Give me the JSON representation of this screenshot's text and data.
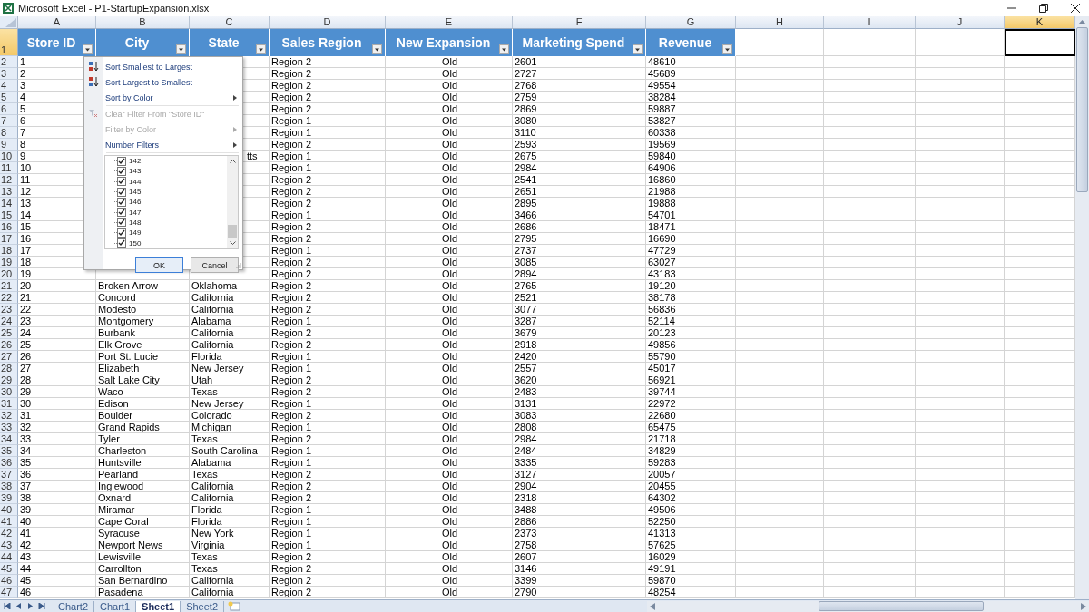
{
  "window": {
    "title": "Microsoft Excel - P1-StartupExpansion.xlsx"
  },
  "columns": [
    {
      "label": "A",
      "selected": false
    },
    {
      "label": "B",
      "selected": false
    },
    {
      "label": "C",
      "selected": false
    },
    {
      "label": "D",
      "selected": false
    },
    {
      "label": "E",
      "selected": false
    },
    {
      "label": "F",
      "selected": false
    },
    {
      "label": "G",
      "selected": false
    },
    {
      "label": "H",
      "selected": false
    },
    {
      "label": "I",
      "selected": false
    },
    {
      "label": "J",
      "selected": false
    },
    {
      "label": "K",
      "selected": true
    }
  ],
  "header_row": {
    "row": "1",
    "selected": true,
    "cells": [
      "Store ID",
      "City",
      "State",
      "Sales Region",
      "New Expansion",
      "Marketing Spend",
      "Revenue"
    ]
  },
  "rows": [
    {
      "row": "2",
      "selected": false,
      "store_id": "1",
      "sales_region": "Region 2",
      "new_expansion": "Old",
      "marketing_spend": "2601",
      "revenue": "48610"
    },
    {
      "row": "3",
      "selected": false,
      "store_id": "2",
      "sales_region": "Region 2",
      "new_expansion": "Old",
      "marketing_spend": "2727",
      "revenue": "45689"
    },
    {
      "row": "4",
      "selected": false,
      "store_id": "3",
      "sales_region": "Region 2",
      "new_expansion": "Old",
      "marketing_spend": "2768",
      "revenue": "49554"
    },
    {
      "row": "5",
      "selected": false,
      "store_id": "4",
      "sales_region": "Region 2",
      "new_expansion": "Old",
      "marketing_spend": "2759",
      "revenue": "38284"
    },
    {
      "row": "6",
      "selected": false,
      "store_id": "5",
      "sales_region": "Region 2",
      "new_expansion": "Old",
      "marketing_spend": "2869",
      "revenue": "59887"
    },
    {
      "row": "7",
      "selected": false,
      "store_id": "6",
      "sales_region": "Region 1",
      "new_expansion": "Old",
      "marketing_spend": "3080",
      "revenue": "53827"
    },
    {
      "row": "8",
      "selected": false,
      "store_id": "7",
      "sales_region": "Region 1",
      "new_expansion": "Old",
      "marketing_spend": "3110",
      "revenue": "60338"
    },
    {
      "row": "9",
      "selected": false,
      "store_id": "8",
      "sales_region": "Region 2",
      "new_expansion": "Old",
      "marketing_spend": "2593",
      "revenue": "19569"
    },
    {
      "row": "10",
      "selected": false,
      "store_id": "9",
      "state_tail": "tts",
      "sales_region": "Region 1",
      "new_expansion": "Old",
      "marketing_spend": "2675",
      "revenue": "59840"
    },
    {
      "row": "11",
      "selected": false,
      "store_id": "10",
      "sales_region": "Region 1",
      "new_expansion": "Old",
      "marketing_spend": "2984",
      "revenue": "64906"
    },
    {
      "row": "12",
      "selected": false,
      "store_id": "11",
      "sales_region": "Region 2",
      "new_expansion": "Old",
      "marketing_spend": "2541",
      "revenue": "16860"
    },
    {
      "row": "13",
      "selected": false,
      "store_id": "12",
      "sales_region": "Region 2",
      "new_expansion": "Old",
      "marketing_spend": "2651",
      "revenue": "21988"
    },
    {
      "row": "14",
      "selected": false,
      "store_id": "13",
      "sales_region": "Region 2",
      "new_expansion": "Old",
      "marketing_spend": "2895",
      "revenue": "19888"
    },
    {
      "row": "15",
      "selected": false,
      "store_id": "14",
      "sales_region": "Region 1",
      "new_expansion": "Old",
      "marketing_spend": "3466",
      "revenue": "54701"
    },
    {
      "row": "16",
      "selected": false,
      "store_id": "15",
      "sales_region": "Region 2",
      "new_expansion": "Old",
      "marketing_spend": "2686",
      "revenue": "18471"
    },
    {
      "row": "17",
      "selected": false,
      "store_id": "16",
      "sales_region": "Region 2",
      "new_expansion": "Old",
      "marketing_spend": "2795",
      "revenue": "16690"
    },
    {
      "row": "18",
      "selected": false,
      "store_id": "17",
      "sales_region": "Region 1",
      "new_expansion": "Old",
      "marketing_spend": "2737",
      "revenue": "47729"
    },
    {
      "row": "19",
      "selected": false,
      "store_id": "18",
      "sales_region": "Region 2",
      "new_expansion": "Old",
      "marketing_spend": "3085",
      "revenue": "63027"
    },
    {
      "row": "20",
      "selected": false,
      "store_id": "19",
      "sales_region": "Region 2",
      "new_expansion": "Old",
      "marketing_spend": "2894",
      "revenue": "43183"
    },
    {
      "row": "21",
      "selected": false,
      "store_id": "20",
      "city": "Broken Arrow",
      "state": "Oklahoma",
      "sales_region": "Region 2",
      "new_expansion": "Old",
      "marketing_spend": "2765",
      "revenue": "19120"
    },
    {
      "row": "22",
      "selected": false,
      "store_id": "21",
      "city": "Concord",
      "state": "California",
      "sales_region": "Region 2",
      "new_expansion": "Old",
      "marketing_spend": "2521",
      "revenue": "38178"
    },
    {
      "row": "23",
      "selected": false,
      "store_id": "22",
      "city": "Modesto",
      "state": "California",
      "sales_region": "Region 2",
      "new_expansion": "Old",
      "marketing_spend": "3077",
      "revenue": "56836"
    },
    {
      "row": "24",
      "selected": false,
      "store_id": "23",
      "city": "Montgomery",
      "state": "Alabama",
      "sales_region": "Region 1",
      "new_expansion": "Old",
      "marketing_spend": "3287",
      "revenue": "52114"
    },
    {
      "row": "25",
      "selected": false,
      "store_id": "24",
      "city": "Burbank",
      "state": "California",
      "sales_region": "Region 2",
      "new_expansion": "Old",
      "marketing_spend": "3679",
      "revenue": "20123"
    },
    {
      "row": "26",
      "selected": false,
      "store_id": "25",
      "city": "Elk Grove",
      "state": "California",
      "sales_region": "Region 2",
      "new_expansion": "Old",
      "marketing_spend": "2918",
      "revenue": "49856"
    },
    {
      "row": "27",
      "selected": false,
      "store_id": "26",
      "city": "Port St. Lucie",
      "state": "Florida",
      "sales_region": "Region 1",
      "new_expansion": "Old",
      "marketing_spend": "2420",
      "revenue": "55790"
    },
    {
      "row": "28",
      "selected": false,
      "store_id": "27",
      "city": "Elizabeth",
      "state": "New Jersey",
      "sales_region": "Region 1",
      "new_expansion": "Old",
      "marketing_spend": "2557",
      "revenue": "45017"
    },
    {
      "row": "29",
      "selected": false,
      "store_id": "28",
      "city": "Salt Lake City",
      "state": "Utah",
      "sales_region": "Region 2",
      "new_expansion": "Old",
      "marketing_spend": "3620",
      "revenue": "56921"
    },
    {
      "row": "30",
      "selected": false,
      "store_id": "29",
      "city": "Waco",
      "state": "Texas",
      "sales_region": "Region 2",
      "new_expansion": "Old",
      "marketing_spend": "2483",
      "revenue": "39744"
    },
    {
      "row": "31",
      "selected": false,
      "store_id": "30",
      "city": "Edison",
      "state": "New Jersey",
      "sales_region": "Region 1",
      "new_expansion": "Old",
      "marketing_spend": "3131",
      "revenue": "22972"
    },
    {
      "row": "32",
      "selected": false,
      "store_id": "31",
      "city": "Boulder",
      "state": "Colorado",
      "sales_region": "Region 2",
      "new_expansion": "Old",
      "marketing_spend": "3083",
      "revenue": "22680"
    },
    {
      "row": "33",
      "selected": false,
      "store_id": "32",
      "city": "Grand Rapids",
      "state": "Michigan",
      "sales_region": "Region 1",
      "new_expansion": "Old",
      "marketing_spend": "2808",
      "revenue": "65475"
    },
    {
      "row": "34",
      "selected": false,
      "store_id": "33",
      "city": "Tyler",
      "state": "Texas",
      "sales_region": "Region 2",
      "new_expansion": "Old",
      "marketing_spend": "2984",
      "revenue": "21718"
    },
    {
      "row": "35",
      "selected": false,
      "store_id": "34",
      "city": "Charleston",
      "state": "South Carolina",
      "sales_region": "Region 1",
      "new_expansion": "Old",
      "marketing_spend": "2484",
      "revenue": "34829"
    },
    {
      "row": "36",
      "selected": false,
      "store_id": "35",
      "city": "Huntsville",
      "state": "Alabama",
      "sales_region": "Region 1",
      "new_expansion": "Old",
      "marketing_spend": "3335",
      "revenue": "59283"
    },
    {
      "row": "37",
      "selected": false,
      "store_id": "36",
      "city": "Pearland",
      "state": "Texas",
      "sales_region": "Region 2",
      "new_expansion": "Old",
      "marketing_spend": "3127",
      "revenue": "20057"
    },
    {
      "row": "38",
      "selected": false,
      "store_id": "37",
      "city": "Inglewood",
      "state": "California",
      "sales_region": "Region 2",
      "new_expansion": "Old",
      "marketing_spend": "2904",
      "revenue": "20455"
    },
    {
      "row": "39",
      "selected": false,
      "store_id": "38",
      "city": "Oxnard",
      "state": "California",
      "sales_region": "Region 2",
      "new_expansion": "Old",
      "marketing_spend": "2318",
      "revenue": "64302"
    },
    {
      "row": "40",
      "selected": false,
      "store_id": "39",
      "city": "Miramar",
      "state": "Florida",
      "sales_region": "Region 1",
      "new_expansion": "Old",
      "marketing_spend": "3488",
      "revenue": "49506"
    },
    {
      "row": "41",
      "selected": false,
      "store_id": "40",
      "city": "Cape Coral",
      "state": "Florida",
      "sales_region": "Region 1",
      "new_expansion": "Old",
      "marketing_spend": "2886",
      "revenue": "52250"
    },
    {
      "row": "42",
      "selected": false,
      "store_id": "41",
      "city": "Syracuse",
      "state": "New York",
      "sales_region": "Region 1",
      "new_expansion": "Old",
      "marketing_spend": "2373",
      "revenue": "41313"
    },
    {
      "row": "43",
      "selected": false,
      "store_id": "42",
      "city": "Newport News",
      "state": "Virginia",
      "sales_region": "Region 1",
      "new_expansion": "Old",
      "marketing_spend": "2758",
      "revenue": "57625"
    },
    {
      "row": "44",
      "selected": false,
      "store_id": "43",
      "city": "Lewisville",
      "state": "Texas",
      "sales_region": "Region 2",
      "new_expansion": "Old",
      "marketing_spend": "2607",
      "revenue": "16029"
    },
    {
      "row": "45",
      "selected": false,
      "store_id": "44",
      "city": "Carrollton",
      "state": "Texas",
      "sales_region": "Region 2",
      "new_expansion": "Old",
      "marketing_spend": "3146",
      "revenue": "49191"
    },
    {
      "row": "46",
      "selected": false,
      "store_id": "45",
      "city": "San Bernardino",
      "state": "California",
      "sales_region": "Region 2",
      "new_expansion": "Old",
      "marketing_spend": "3399",
      "revenue": "59870"
    },
    {
      "row": "47",
      "selected": false,
      "store_id": "46",
      "city": "Pasadena",
      "state": "California",
      "sales_region": "Region 2",
      "new_expansion": "Old",
      "marketing_spend": "2790",
      "revenue": "48254"
    }
  ],
  "filter_menu": {
    "items": [
      {
        "kind": "sort_ascending",
        "label": "Sort Smallest to Largest",
        "disabled": false
      },
      {
        "kind": "sort_descending",
        "label": "Sort Largest to Smallest",
        "disabled": false
      },
      {
        "kind": "submenu",
        "label": "Sort by Color",
        "disabled": false
      },
      {
        "kind": "separator"
      },
      {
        "kind": "clear_filter",
        "label": "Clear Filter From \"Store ID\"",
        "disabled": true
      },
      {
        "kind": "submenu",
        "label": "Filter by Color",
        "disabled": true
      },
      {
        "kind": "submenu",
        "label": "Number Filters",
        "disabled": false
      }
    ],
    "values": [
      {
        "label": "142",
        "checked": true
      },
      {
        "label": "143",
        "checked": true
      },
      {
        "label": "144",
        "checked": true
      },
      {
        "label": "145",
        "checked": true
      },
      {
        "label": "146",
        "checked": true
      },
      {
        "label": "147",
        "checked": true
      },
      {
        "label": "148",
        "checked": true
      },
      {
        "label": "149",
        "checked": true
      },
      {
        "label": "150",
        "checked": true
      }
    ],
    "buttons": [
      {
        "label": "OK",
        "default": true
      },
      {
        "label": "Cancel",
        "default": false
      }
    ]
  },
  "sheet_tabs": [
    {
      "label": "Chart2",
      "selected": false
    },
    {
      "label": "Chart1",
      "selected": false
    },
    {
      "label": "Sheet1",
      "selected": true
    },
    {
      "label": "Sheet2",
      "selected": false
    }
  ]
}
